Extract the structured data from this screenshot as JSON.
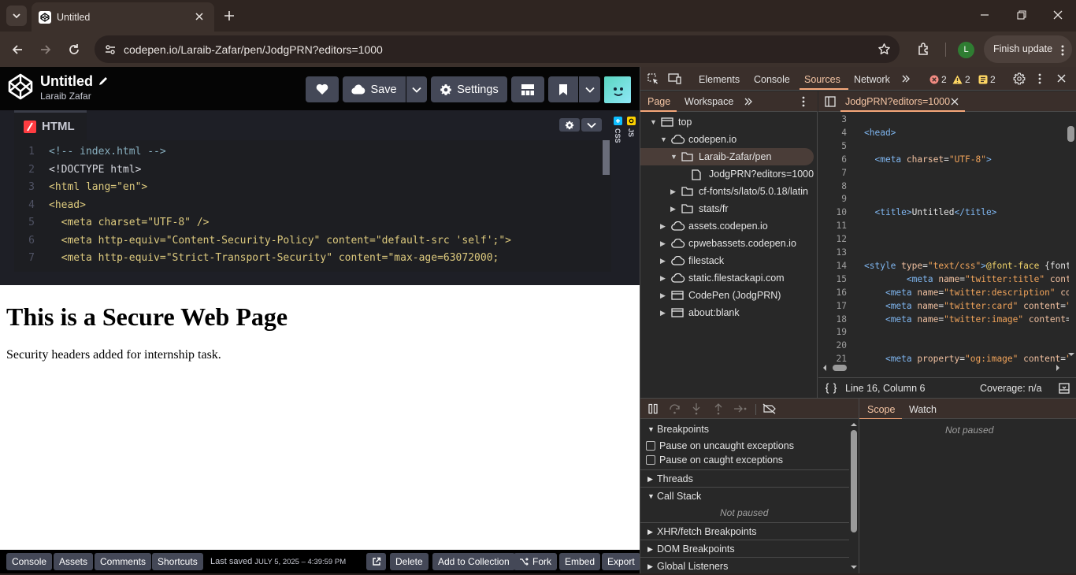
{
  "browser": {
    "tab_title": "Untitled",
    "url": "codepen.io/Laraib-Zafar/pen/JodgPRN?editors=1000",
    "profile_initial": "L",
    "finish_update_label": "Finish update"
  },
  "codepen": {
    "pen_title": "Untitled",
    "author": "Laraib Zafar",
    "save_label": "Save",
    "settings_label": "Settings",
    "html_tab_label": "HTML",
    "css_label": "CSS",
    "js_label": "JS",
    "code_lines": [
      {
        "n": "1",
        "text": "<!-- index.html -->"
      },
      {
        "n": "2",
        "text": "<!DOCTYPE html>"
      },
      {
        "n": "3",
        "text": "<html lang=\"en\">"
      },
      {
        "n": "4",
        "text": "<head>"
      },
      {
        "n": "5",
        "text": "  <meta charset=\"UTF-8\" />"
      },
      {
        "n": "6",
        "text": "  <meta http-equiv=\"Content-Security-Policy\" content=\"default-src 'self';\">"
      },
      {
        "n": "7",
        "text": "  <meta http-equiv=\"Strict-Transport-Security\" content=\"max-age=63072000;"
      }
    ],
    "preview": {
      "heading": "This is a Secure Web Page",
      "paragraph": "Security headers added for internship task."
    },
    "footer": {
      "console": "Console",
      "assets": "Assets",
      "comments": "Comments",
      "shortcuts": "Shortcuts",
      "last_saved_label": "Last saved",
      "last_saved_date": "JULY 5, 2025 – 4:39:59 PM",
      "delete": "Delete",
      "add_to_collection": "Add to Collection",
      "fork": "Fork",
      "embed": "Embed",
      "export": "Export"
    }
  },
  "devtools": {
    "tabs": [
      "Elements",
      "Console",
      "Sources",
      "Network"
    ],
    "active_tab": "Sources",
    "errors": "2",
    "warnings": "2",
    "issues": "2",
    "nav_tabs": [
      "Page",
      "Workspace"
    ],
    "tree": [
      {
        "label": "top",
        "depth": 0,
        "icon": "frame",
        "open": true
      },
      {
        "label": "codepen.io",
        "depth": 1,
        "icon": "cloud",
        "open": true
      },
      {
        "label": "Laraib-Zafar/pen",
        "depth": 2,
        "icon": "folder",
        "open": true,
        "selected": true
      },
      {
        "label": "JodgPRN?editors=1000",
        "depth": 3,
        "icon": "file"
      },
      {
        "label": "cf-fonts/s/lato/5.0.18/latin",
        "depth": 2,
        "icon": "folder"
      },
      {
        "label": "stats/fr",
        "depth": 2,
        "icon": "folder"
      },
      {
        "label": "assets.codepen.io",
        "depth": 1,
        "icon": "cloud"
      },
      {
        "label": "cpwebassets.codepen.io",
        "depth": 1,
        "icon": "cloud"
      },
      {
        "label": "filestack",
        "depth": 1,
        "icon": "cloud"
      },
      {
        "label": "static.filestackapi.com",
        "depth": 1,
        "icon": "cloud"
      },
      {
        "label": "CodePen (JodgPRN)",
        "depth": 1,
        "icon": "frame"
      },
      {
        "label": "about:blank",
        "depth": 1,
        "icon": "frame"
      }
    ],
    "open_file": "JodgPRN?editors=1000",
    "source_lines": [
      {
        "n": "3",
        "html": ""
      },
      {
        "n": "4",
        "html": "<span class='tgc'>&lt;head&gt;</span>"
      },
      {
        "n": "5",
        "html": ""
      },
      {
        "n": "6",
        "html": "  <span class='tgc'>&lt;meta</span> <span class='atc'>charset</span><span class='txc'>=</span><span class='stc'>\"UTF-8\"</span><span class='tgc'>&gt;</span>"
      },
      {
        "n": "7",
        "html": ""
      },
      {
        "n": "8",
        "html": ""
      },
      {
        "n": "9",
        "html": ""
      },
      {
        "n": "10",
        "html": "  <span class='tgc'>&lt;title&gt;</span><span class='txc'>Untitled</span><span class='tgc'>&lt;/title&gt;</span>"
      },
      {
        "n": "11",
        "html": ""
      },
      {
        "n": "12",
        "html": ""
      },
      {
        "n": "13",
        "html": ""
      },
      {
        "n": "14",
        "html": "<span class='tgc'>&lt;style</span> <span class='atc'>type</span><span class='txc'>=</span><span class='stc'>\"text/css\"</span><span class='tgc'>&gt;</span><span class='kwc'>@font-face</span> <span class='txc'>{font</span>"
      },
      {
        "n": "15",
        "html": "        <span class='tgc'>&lt;meta</span> <span class='atc'>name</span><span class='txc'>=</span><span class='stc'>\"twitter:title\"</span> <span class='atc'>conten</span>"
      },
      {
        "n": "16",
        "html": "    <span class='tgc'>&lt;meta</span> <span class='atc'>name</span><span class='txc'>=</span><span class='stc'>\"twitter:description\"</span> <span class='atc'>co</span>"
      },
      {
        "n": "17",
        "html": "    <span class='tgc'>&lt;meta</span> <span class='atc'>name</span><span class='txc'>=</span><span class='stc'>\"twitter:card\"</span> <span class='atc'>content</span><span class='txc'>=</span><span class='stc'>\"</span>"
      },
      {
        "n": "18",
        "html": "    <span class='tgc'>&lt;meta</span> <span class='atc'>name</span><span class='txc'>=</span><span class='stc'>\"twitter:image\"</span> <span class='atc'>content</span><span class='txc'>=</span>"
      },
      {
        "n": "19",
        "html": ""
      },
      {
        "n": "20",
        "html": ""
      },
      {
        "n": "21",
        "html": "    <span class='tgc'>&lt;meta</span> <span class='atc'>property</span><span class='txc'>=</span><span class='stc'>\"og:image\"</span> <span class='atc'>content</span><span class='txc'>=</span><span class='stc'>\"</span>"
      }
    ],
    "cursor_position": "Line 16, Column 6",
    "coverage": "Coverage: n/a",
    "scope_tabs": [
      "Scope",
      "Watch"
    ],
    "not_paused": "Not paused",
    "breakpoints_label": "Breakpoints",
    "pause_uncaught": "Pause on uncaught exceptions",
    "pause_caught": "Pause on caught exceptions",
    "threads_label": "Threads",
    "call_stack_label": "Call Stack",
    "xhr_label": "XHR/fetch Breakpoints",
    "dom_label": "DOM Breakpoints",
    "global_label": "Global Listeners"
  }
}
